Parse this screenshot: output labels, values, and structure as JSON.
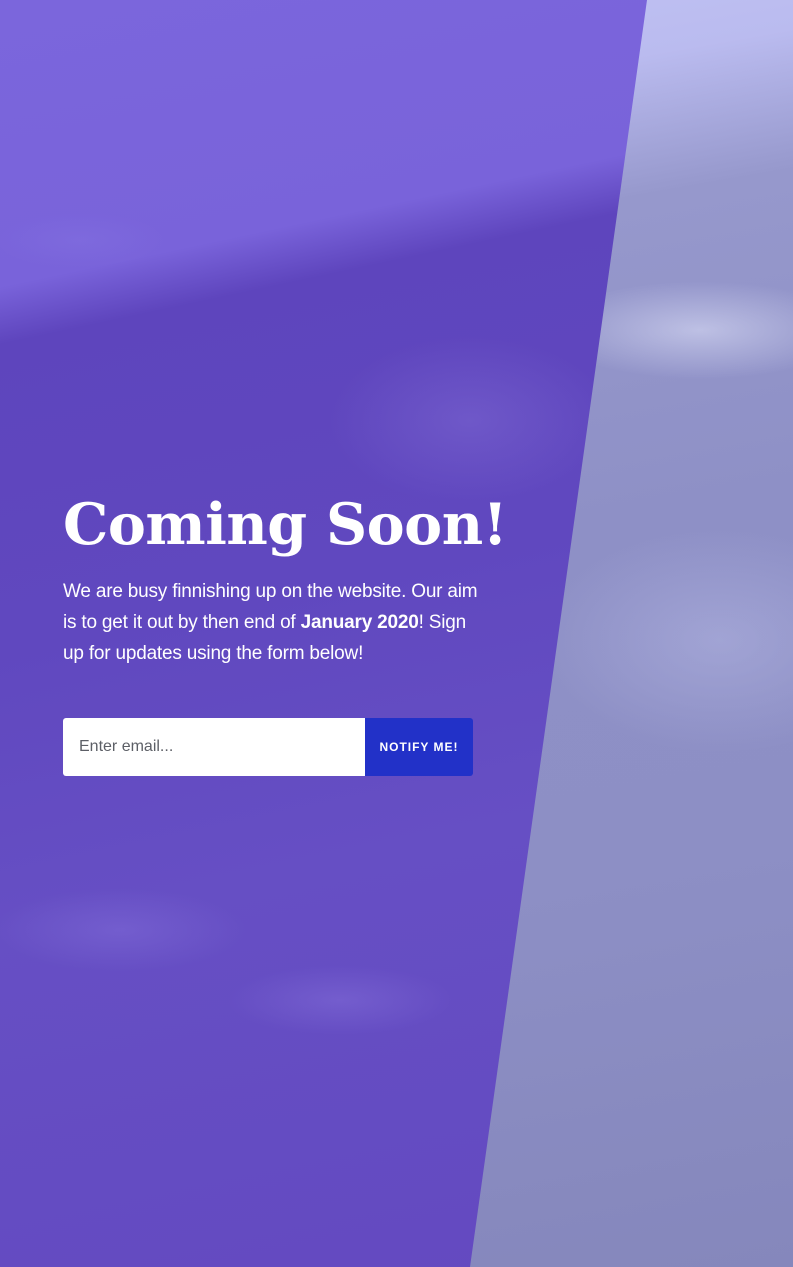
{
  "hero": {
    "title": "Coming Soon!",
    "description_before": "We are busy finnishing up on the website. Our aim is to get it out by then end of ",
    "description_emphasis": "January 2020",
    "description_after": "! Sign up for updates using the form below!"
  },
  "signup_form": {
    "email_placeholder": "Enter email...",
    "email_value": "",
    "submit_label": "NOTIFY ME!"
  },
  "colors": {
    "panel": "#6048bf",
    "button": "#2231c8",
    "text": "#ffffff"
  }
}
